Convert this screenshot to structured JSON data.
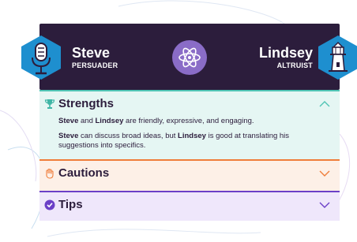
{
  "header": {
    "left": {
      "name": "Steve",
      "role": "PERSUADER",
      "icon": "microphone-icon"
    },
    "right": {
      "name": "Lindsey",
      "role": "ALTRUIST",
      "icon": "lighthouse-icon"
    },
    "center_icon": "atom-icon"
  },
  "sections": {
    "strengths": {
      "title": "Strengths",
      "icon": "trophy-icon",
      "expanded": true,
      "line1": {
        "name_a": "Steve",
        "and": " and ",
        "name_b": "Lindsey",
        "rest": " are friendly, expressive, and engaging."
      },
      "line2": {
        "name_a": "Steve",
        "mid": " can discuss broad ideas, but ",
        "name_b": "Lindsey",
        "rest": " is good at translating his suggestions into specifics."
      }
    },
    "cautions": {
      "title": "Cautions",
      "icon": "hand-icon",
      "expanded": false
    },
    "tips": {
      "title": "Tips",
      "icon": "check-circle-icon",
      "expanded": false
    }
  },
  "colors": {
    "header_bg": "#2c1d3c",
    "hex_blue": "#1e8fcf",
    "strengths_accent": "#4fc4b4",
    "cautions_accent": "#ef7d3a",
    "tips_accent": "#6b3fc7"
  }
}
